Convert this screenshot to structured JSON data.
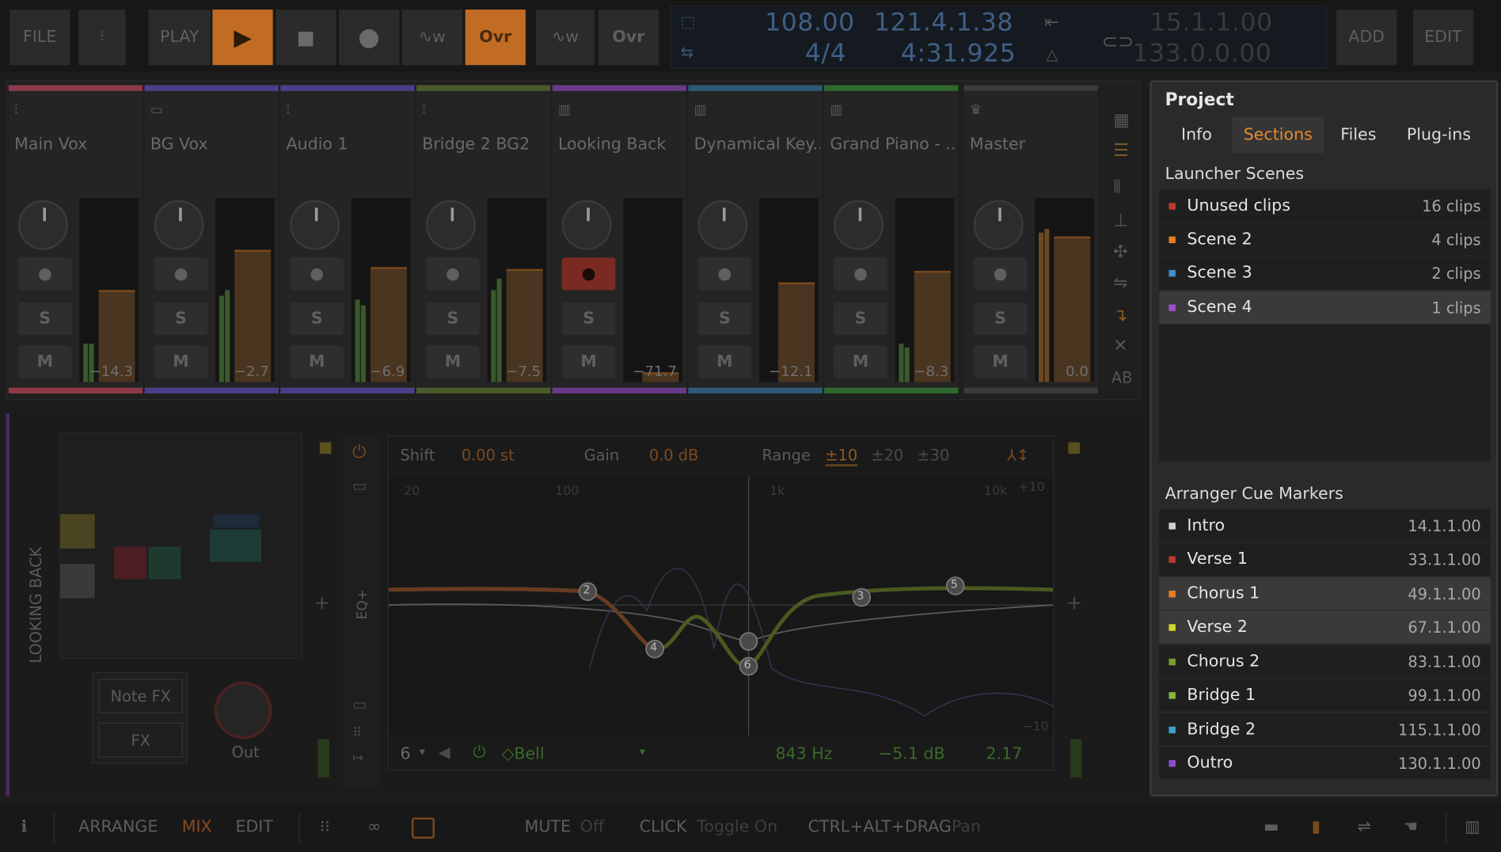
{
  "transport": {
    "file": "FILE",
    "play": "PLAY",
    "ovr1": "Ovr",
    "ovr2": "Ovr",
    "tempo": "108.00",
    "signature": "4/4",
    "position_bars": "121.4.1.38",
    "position_time": "4:31.925",
    "loop_start": "15.1.1.00",
    "loop_end": "133.0.0.00",
    "add": "ADD",
    "edit": "EDIT"
  },
  "mixer": {
    "tracks": [
      {
        "name": "Main Vox",
        "color": "#8e3a48",
        "db": "−14.3",
        "icon": "audio-wave-icon"
      },
      {
        "name": "BG Vox",
        "color": "#4b3f8a",
        "db": "−2.7",
        "icon": "folder-icon"
      },
      {
        "name": "Audio 1",
        "color": "#4b3f8a",
        "db": "−6.9",
        "icon": "audio-wave-icon"
      },
      {
        "name": "Bridge 2 BG2",
        "color": "#4b5a2a",
        "db": "−7.5",
        "icon": "audio-wave-icon"
      },
      {
        "name": "Looking Back",
        "color": "#6a3a8a",
        "db": "−71.7",
        "icon": "piano-icon"
      },
      {
        "name": "Dynamical Key...",
        "color": "#2e5a78",
        "db": "−12.1",
        "icon": "piano-icon"
      },
      {
        "name": "Grand Piano - ...",
        "color": "#2e6a2e",
        "db": "−8.3",
        "icon": "piano-icon"
      },
      {
        "name": "Master",
        "color": "#3a3a3a",
        "db": "0.0",
        "icon": "crown-icon"
      }
    ],
    "solo": "S",
    "mute": "M"
  },
  "device": {
    "track_name": "LOOKING BACK",
    "note_fx": "Note FX",
    "fx": "FX",
    "out": "Out",
    "eq_label": "EQ+",
    "shift_label": "Shift",
    "shift_value": "0.00 st",
    "gain_label": "Gain",
    "gain_value": "0.0 dB",
    "range_label": "Range",
    "range_options": [
      "±10",
      "±20",
      "±30"
    ],
    "freq_ticks": [
      "20",
      "100",
      "1k",
      "10k"
    ],
    "db_top": "+10",
    "db_bottom": "−10",
    "band": "6",
    "band_type": "Bell",
    "band_freq": "843 Hz",
    "band_gain": "−5.1 dB",
    "band_q": "2.17",
    "nodes": [
      "2",
      "4",
      "6",
      "3",
      "5"
    ]
  },
  "panel": {
    "title": "Project",
    "tabs": [
      "Info",
      "Sections",
      "Files",
      "Plug-ins"
    ],
    "active_tab": "Sections",
    "launcher_title": "Launcher Scenes",
    "scenes": [
      {
        "name": "Unused clips",
        "count": "16 clips",
        "color": "#c0392b"
      },
      {
        "name": "Scene 2",
        "count": "4 clips",
        "color": "#e67e22"
      },
      {
        "name": "Scene 3",
        "count": "2 clips",
        "color": "#3a8ed0"
      },
      {
        "name": "Scene 4",
        "count": "1 clips",
        "color": "#9b4fd0"
      }
    ],
    "cue_title": "Arranger Cue Markers",
    "cues": [
      {
        "name": "Intro",
        "pos": "14.1.1.00",
        "color": "#cfcfcf"
      },
      {
        "name": "Verse 1",
        "pos": "33.1.1.00",
        "color": "#c0392b"
      },
      {
        "name": "Chorus 1",
        "pos": "49.1.1.00",
        "color": "#e67e22"
      },
      {
        "name": "Verse 2",
        "pos": "67.1.1.00",
        "color": "#d4d42a"
      },
      {
        "name": "Chorus 2",
        "pos": "83.1.1.00",
        "color": "#7aa02a"
      },
      {
        "name": "Bridge 1",
        "pos": "99.1.1.00",
        "color": "#8ab43a"
      },
      {
        "name": "Bridge 2",
        "pos": "115.1.1.00",
        "color": "#3aa0d0"
      },
      {
        "name": "Outro",
        "pos": "130.1.1.00",
        "color": "#8a4fd0"
      }
    ]
  },
  "bottom": {
    "arrange": "ARRANGE",
    "mix": "MIX",
    "edit": "EDIT",
    "mute_label": "MUTE",
    "mute_value": "Off",
    "click_label": "CLICK",
    "click_value": "Toggle On",
    "drag_label": "CTRL+ALT+DRAG",
    "drag_value": "Pan"
  }
}
